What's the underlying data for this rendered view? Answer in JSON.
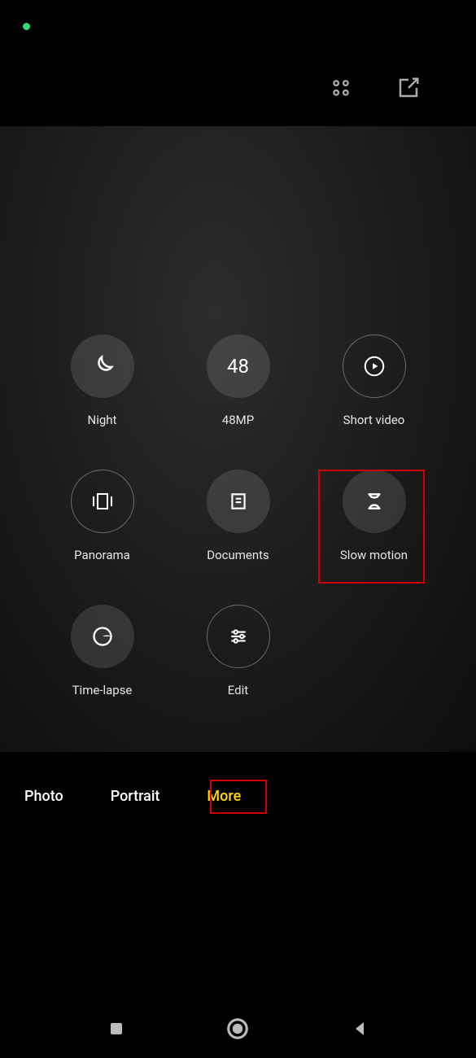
{
  "modes": {
    "night": "Night",
    "mp48": "48MP",
    "mp48_icon": "48",
    "shortvideo": "Short video",
    "panorama": "Panorama",
    "documents": "Documents",
    "slowmotion": "Slow motion",
    "timelapse": "Time-lapse",
    "edit": "Edit"
  },
  "tabs": {
    "photo": "Photo",
    "portrait": "Portrait",
    "more": "More"
  }
}
